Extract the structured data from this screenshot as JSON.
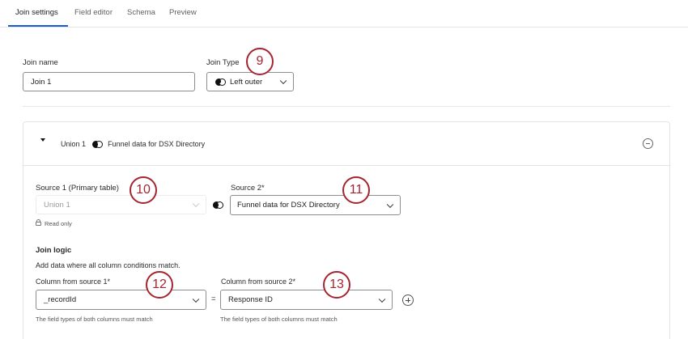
{
  "tabs": [
    {
      "label": "Join settings",
      "active": true
    },
    {
      "label": "Field editor"
    },
    {
      "label": "Schema"
    },
    {
      "label": "Preview"
    }
  ],
  "join": {
    "name_label": "Join name",
    "name_value": "Join 1",
    "type_label": "Join Type",
    "type_value": "Left outer"
  },
  "panel": {
    "source_name": "Union 1",
    "target_name": "Funnel data for DSX Directory",
    "source1_label": "Source 1 (Primary table)",
    "source1_value": "Union 1",
    "read_only": "Read only",
    "source2_label": "Source 2*",
    "source2_value": "Funnel data for DSX Directory",
    "join_logic_title": "Join logic",
    "join_logic_desc": "Add data where all column conditions match.",
    "col1_label": "Column from source 1*",
    "col1_value": "_recordId",
    "col2_label": "Column from source 2*",
    "col2_value": "Response ID",
    "equals": "=",
    "hint1": "The field types of both columns must match",
    "hint2": "The field types of both columns must match"
  },
  "callouts": [
    "9",
    "10",
    "11",
    "12",
    "13"
  ],
  "colors": {
    "accent": "#1a5fd0",
    "callout": "#a4252f",
    "border": "#8d8d8d"
  },
  "icons": [
    "join-left-outer-icon",
    "chevron-down-icon",
    "caret-down-icon",
    "remove-circle-icon",
    "lock-icon",
    "add-circle-icon"
  ]
}
